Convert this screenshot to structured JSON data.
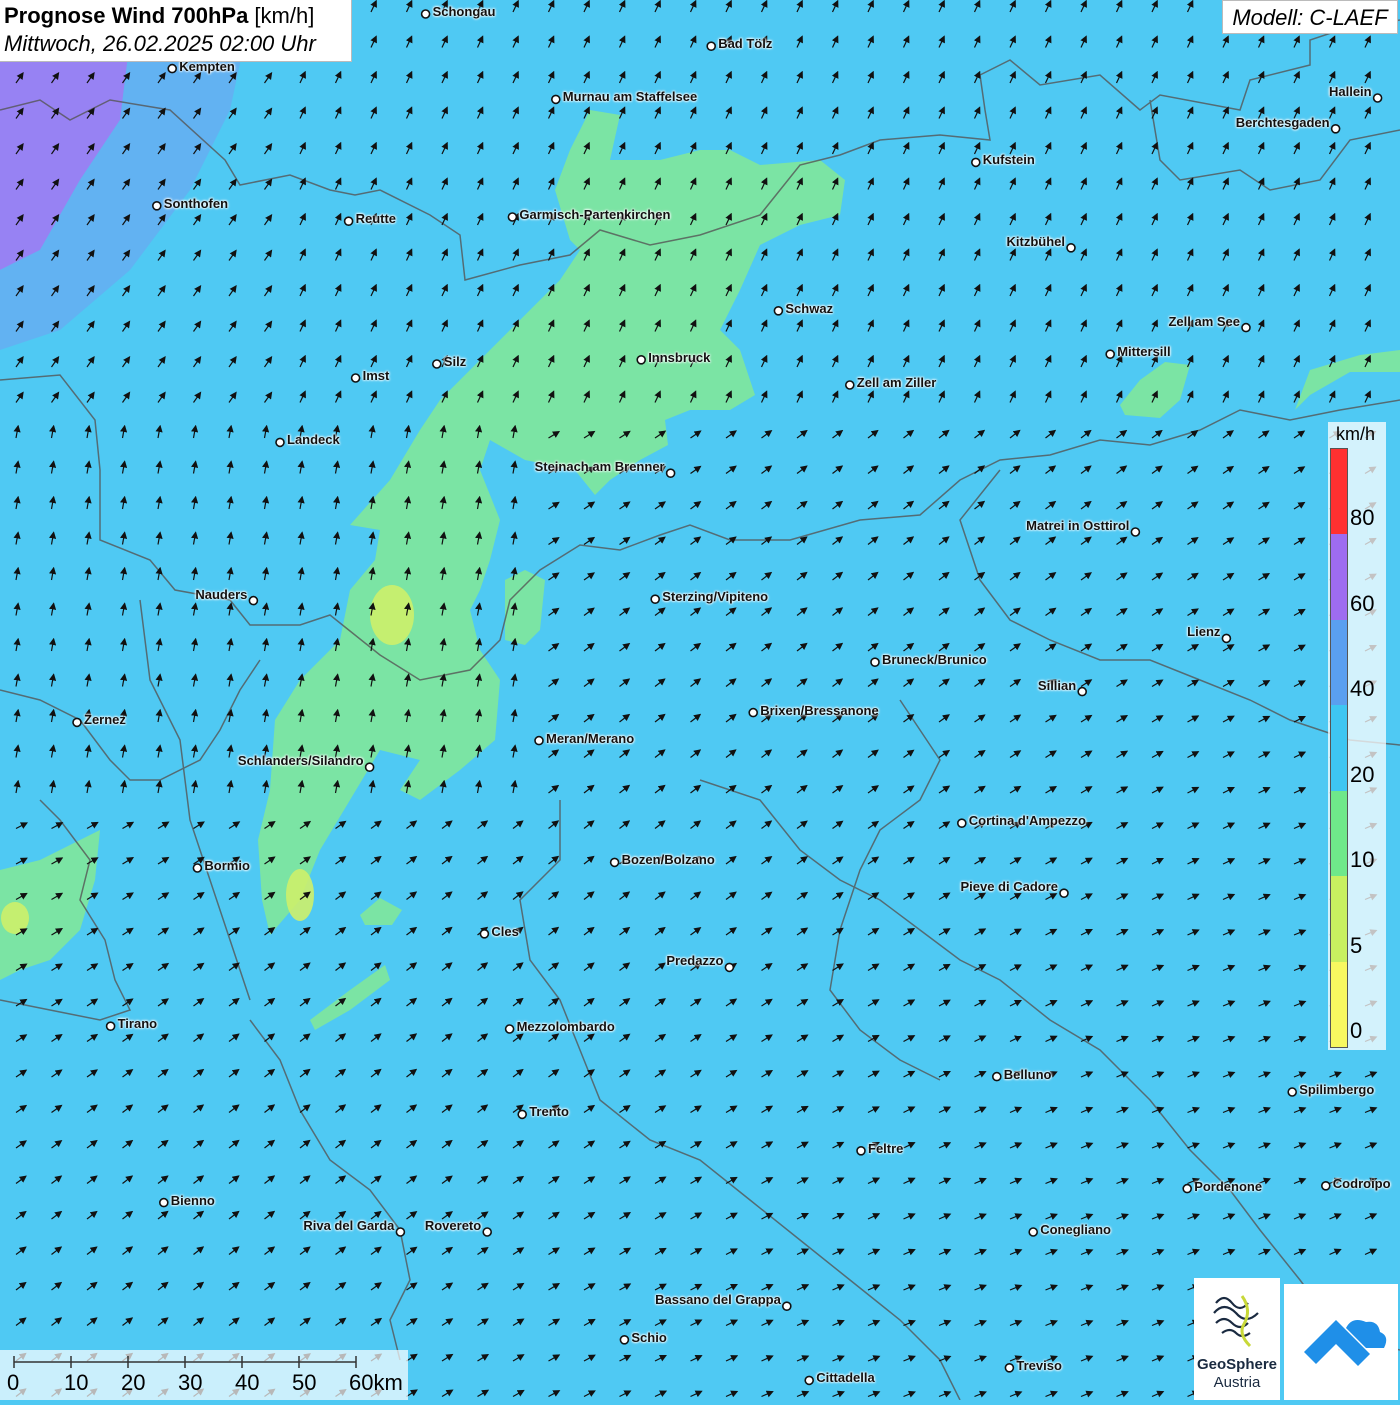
{
  "title": {
    "main": "Prognose Wind 700hPa",
    "unit": " [km/h]",
    "date": "Mittwoch, 26.02.2025 02:00 Uhr"
  },
  "model": "Modell: C-LAEF",
  "legend": {
    "unit": "km/h",
    "labels": [
      "80",
      "60",
      "40",
      "20",
      "10",
      "5",
      "0"
    ],
    "colors": [
      "#ff3030",
      "#9e6cf0",
      "#5a9ff0",
      "#3ec6f2",
      "#6fe88a",
      "#c8f060",
      "#f8f860"
    ]
  },
  "scale": {
    "labels": [
      "0",
      "10",
      "20",
      "30",
      "40",
      "50",
      "60km"
    ]
  },
  "logos": {
    "geo_line1": "GeoSphere",
    "geo_line2": "Austria"
  },
  "cities": [
    {
      "name": "Schongau",
      "lx": 0.304,
      "ly": 0.01,
      "side": "r"
    },
    {
      "name": "Bad Tölz",
      "lx": 0.508,
      "ly": 0.033,
      "side": "r"
    },
    {
      "name": "Kempten",
      "lx": 0.123,
      "ly": 0.049,
      "side": "r"
    },
    {
      "name": "Murnau am Staffelsee",
      "lx": 0.397,
      "ly": 0.071,
      "side": "r"
    },
    {
      "name": "Hallein",
      "lx": 0.984,
      "ly": 0.07,
      "side": "l"
    },
    {
      "name": "Berchtesgaden",
      "lx": 0.954,
      "ly": 0.092,
      "side": "l"
    },
    {
      "name": "Kufstein",
      "lx": 0.697,
      "ly": 0.116,
      "side": "r"
    },
    {
      "name": "Sonthofen",
      "lx": 0.112,
      "ly": 0.147,
      "side": "r"
    },
    {
      "name": "Reutte",
      "lx": 0.249,
      "ly": 0.158,
      "side": "r"
    },
    {
      "name": "Garmisch-Partenkirchen",
      "lx": 0.366,
      "ly": 0.155,
      "side": "r"
    },
    {
      "name": "Kitzbühel",
      "lx": 0.765,
      "ly": 0.177,
      "side": "l"
    },
    {
      "name": "Schwaz",
      "lx": 0.556,
      "ly": 0.222,
      "side": "r"
    },
    {
      "name": "Zell am See",
      "lx": 0.89,
      "ly": 0.234,
      "side": "l"
    },
    {
      "name": "Mittersill",
      "lx": 0.793,
      "ly": 0.253,
      "side": "r"
    },
    {
      "name": "Silz",
      "lx": 0.312,
      "ly": 0.26,
      "side": "r"
    },
    {
      "name": "Innsbruck",
      "lx": 0.458,
      "ly": 0.257,
      "side": "r"
    },
    {
      "name": "Imst",
      "lx": 0.254,
      "ly": 0.27,
      "side": "r"
    },
    {
      "name": "Zell am Ziller",
      "lx": 0.607,
      "ly": 0.275,
      "side": "r"
    },
    {
      "name": "Landeck",
      "lx": 0.2,
      "ly": 0.316,
      "side": "r"
    },
    {
      "name": "Steinach am Brenner",
      "lx": 0.479,
      "ly": 0.338,
      "side": "l"
    },
    {
      "name": "Matrei in Osttirol",
      "lx": 0.811,
      "ly": 0.38,
      "side": "l"
    },
    {
      "name": "Nauders",
      "lx": 0.181,
      "ly": 0.429,
      "side": "l"
    },
    {
      "name": "Sterzing/Vipiteno",
      "lx": 0.468,
      "ly": 0.428,
      "side": "r"
    },
    {
      "name": "Lienz",
      "lx": 0.876,
      "ly": 0.456,
      "side": "l"
    },
    {
      "name": "Bruneck/Brunico",
      "lx": 0.625,
      "ly": 0.473,
      "side": "r"
    },
    {
      "name": "Sillian",
      "lx": 0.773,
      "ly": 0.494,
      "side": "l"
    },
    {
      "name": "Brixen/Bressanone",
      "lx": 0.538,
      "ly": 0.509,
      "side": "r"
    },
    {
      "name": "Zernez",
      "lx": 0.055,
      "ly": 0.516,
      "side": "r"
    },
    {
      "name": "Meran/Merano",
      "lx": 0.385,
      "ly": 0.529,
      "side": "r"
    },
    {
      "name": "Schlanders/Silandro",
      "lx": 0.264,
      "ly": 0.548,
      "side": "l"
    },
    {
      "name": "Cortina d'Ampezzo",
      "lx": 0.687,
      "ly": 0.588,
      "side": "r"
    },
    {
      "name": "Bozen/Bolzano",
      "lx": 0.439,
      "ly": 0.616,
      "side": "r"
    },
    {
      "name": "Bormio",
      "lx": 0.141,
      "ly": 0.62,
      "side": "r"
    },
    {
      "name": "Pieve di Cadore",
      "lx": 0.76,
      "ly": 0.638,
      "side": "l"
    },
    {
      "name": "Cles",
      "lx": 0.346,
      "ly": 0.667,
      "side": "r"
    },
    {
      "name": "Predazzo",
      "lx": 0.521,
      "ly": 0.691,
      "side": "l"
    },
    {
      "name": "Tirano",
      "lx": 0.079,
      "ly": 0.733,
      "side": "r"
    },
    {
      "name": "Mezzolombardo",
      "lx": 0.364,
      "ly": 0.735,
      "side": "r"
    },
    {
      "name": "Belluno",
      "lx": 0.712,
      "ly": 0.769,
      "side": "r"
    },
    {
      "name": "Spilimbergo",
      "lx": 0.923,
      "ly": 0.78,
      "side": "r"
    },
    {
      "name": "Trento",
      "lx": 0.373,
      "ly": 0.796,
      "side": "r"
    },
    {
      "name": "Feltre",
      "lx": 0.615,
      "ly": 0.822,
      "side": "r"
    },
    {
      "name": "Pordenone",
      "lx": 0.848,
      "ly": 0.849,
      "side": "r"
    },
    {
      "name": "Codroipo",
      "lx": 0.947,
      "ly": 0.847,
      "side": "r"
    },
    {
      "name": "Bienno",
      "lx": 0.117,
      "ly": 0.859,
      "side": "r"
    },
    {
      "name": "Riva del Garda",
      "lx": 0.286,
      "ly": 0.88,
      "side": "l"
    },
    {
      "name": "Rovereto",
      "lx": 0.348,
      "ly": 0.88,
      "side": "l"
    },
    {
      "name": "Conegliano",
      "lx": 0.738,
      "ly": 0.88,
      "side": "r"
    },
    {
      "name": "Bassano del Grappa",
      "lx": 0.562,
      "ly": 0.933,
      "side": "l"
    },
    {
      "name": "Schio",
      "lx": 0.446,
      "ly": 0.957,
      "side": "r"
    },
    {
      "name": "Treviso",
      "lx": 0.721,
      "ly": 0.977,
      "side": "r"
    },
    {
      "name": "Cittadella",
      "lx": 0.578,
      "ly": 0.986,
      "side": "r"
    }
  ]
}
